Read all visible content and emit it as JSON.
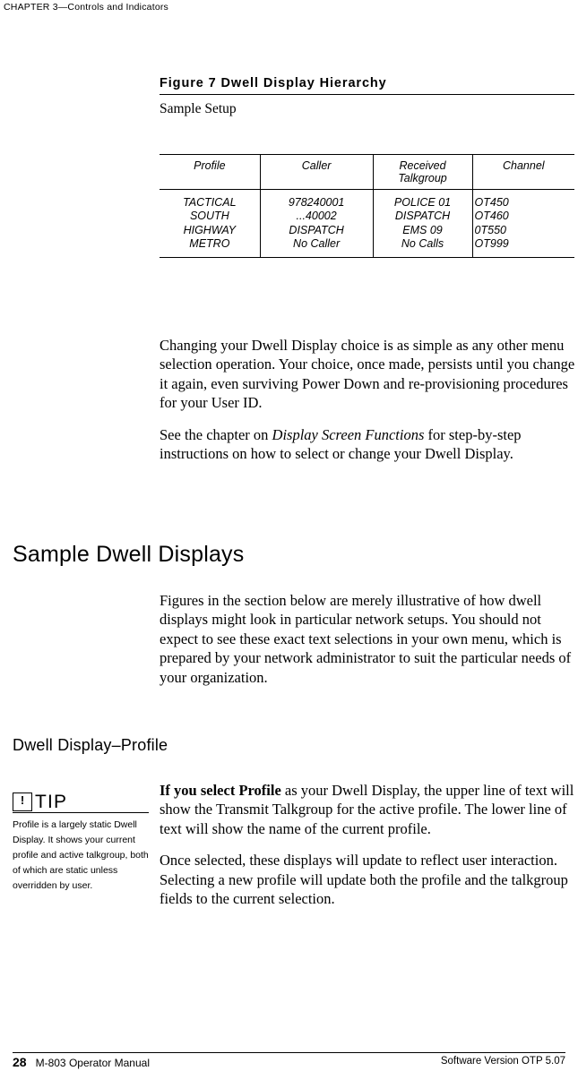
{
  "running_head": "CHAPTER 3—Controls and Indicators",
  "figure": {
    "title": "Figure 7 Dwell Display Hierarchy",
    "caption": "Sample Setup"
  },
  "table": {
    "headers": [
      "Profile",
      "Caller",
      "Received\nTalkgroup",
      "Channel"
    ],
    "rows": [
      {
        "profile": "TACTICAL\nSOUTH\nHIGHWAY\nMETRO",
        "caller": "978240001\n...40002\nDISPATCH\nNo Caller",
        "talkgroup": "POLICE 01\nDISPATCH\nEMS 09\nNo Calls",
        "channel": "OT450\nOT460\n0T550\nOT999"
      }
    ]
  },
  "body": {
    "p1": "Changing your Dwell Display choice is as simple as any other menu selection operation. Your choice, once made, persists until you change it again, even surviving Power Down and re-provisioning procedures for your User ID.",
    "p2_before": "See the chapter on ",
    "p2_italic": "Display Screen Functions",
    "p2_after": " for step-by-step instructions on how to select or change your Dwell Display.",
    "heading1": "Sample Dwell Displays",
    "p3": "Figures in the section below are merely illustrative of how dwell displays might look in particular network setups. You should not expect to see these exact text selections in your own menu, which is prepared by your network administrator to suit the particular needs of your organization.",
    "heading2": "Dwell Display–Profile",
    "p4_bold": "If you select Profile",
    "p4_rest": " as your Dwell Display, the upper line of text will show the Transmit Talkgroup for the active profile. The lower line of text will show the name of the current profile.",
    "p5": "Once selected, these displays will update to reflect user interaction. Selecting a new profile will update both the profile and the talkgroup fields to the current selection."
  },
  "tip": {
    "icon_glyph": "!",
    "label": "TIP",
    "text": "Profile is a largely static Dwell Display. It shows your current profile and active talkgroup, both of which are static unless overridden by user."
  },
  "footer": {
    "page_number": "28",
    "manual_title": "M-803 Operator Manual",
    "version": "Software Version OTP 5.07"
  }
}
